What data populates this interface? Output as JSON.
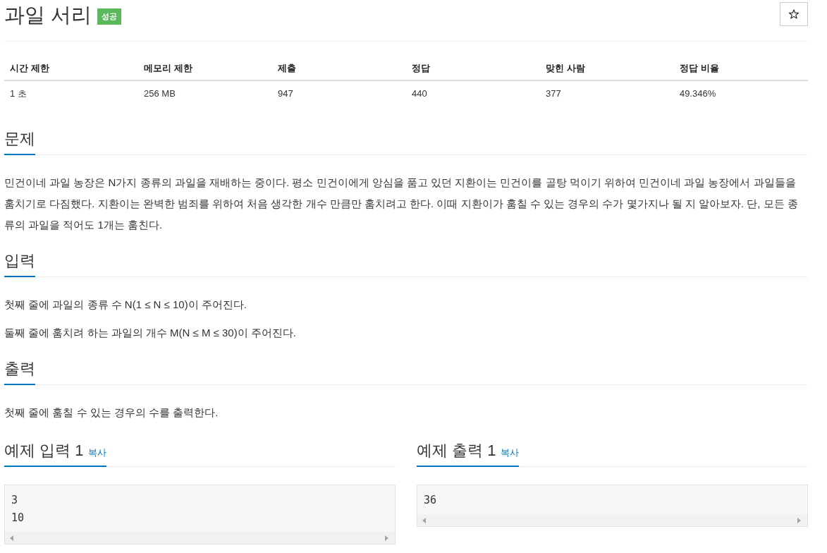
{
  "problem": {
    "title": "과일 서리",
    "status_badge": "성공"
  },
  "stats": {
    "columns": [
      "시간 제한",
      "메모리 제한",
      "제출",
      "정답",
      "맞힌 사람",
      "정답 비율"
    ],
    "rows": [
      [
        "1 초",
        "256 MB",
        "947",
        "440",
        "377",
        "49.346%"
      ]
    ]
  },
  "sections": [
    {
      "heading": "문제",
      "paragraphs": [
        "민건이네 과일 농장은 N가지 종류의 과일을 재배하는 중이다. 평소 민건이에게 앙심을 품고 있던 지환이는 민건이를 골탕 먹이기 위하여 민건이네 과일 농장에서 과일들을 훔치기로 다짐했다. 지환이는 완벽한 범죄를 위하여 처음 생각한 개수 만큼만 훔치려고 한다. 이때 지환이가 훔칠 수 있는 경우의 수가 몇가지나 될 지 알아보자. 단, 모든 종류의 과일을 적어도 1개는 훔친다."
      ]
    },
    {
      "heading": "입력",
      "paragraphs": [
        "첫째 줄에 과일의 종류 수 N(1 ≤ N ≤ 10)이 주어진다.",
        "둘째 줄에 훔치려 하는 과일의 개수 M(N ≤ M ≤ 30)이 주어진다."
      ]
    },
    {
      "heading": "출력",
      "paragraphs": [
        "첫째 줄에 훔칠 수 있는 경우의 수를 출력한다."
      ]
    }
  ],
  "samples": [
    {
      "heading": "예제 입력 1",
      "copy_link": "복사",
      "lines": [
        "3",
        "10"
      ]
    },
    {
      "heading": "예제 출력 1",
      "copy_link": "복사",
      "lines": [
        "36"
      ]
    }
  ]
}
